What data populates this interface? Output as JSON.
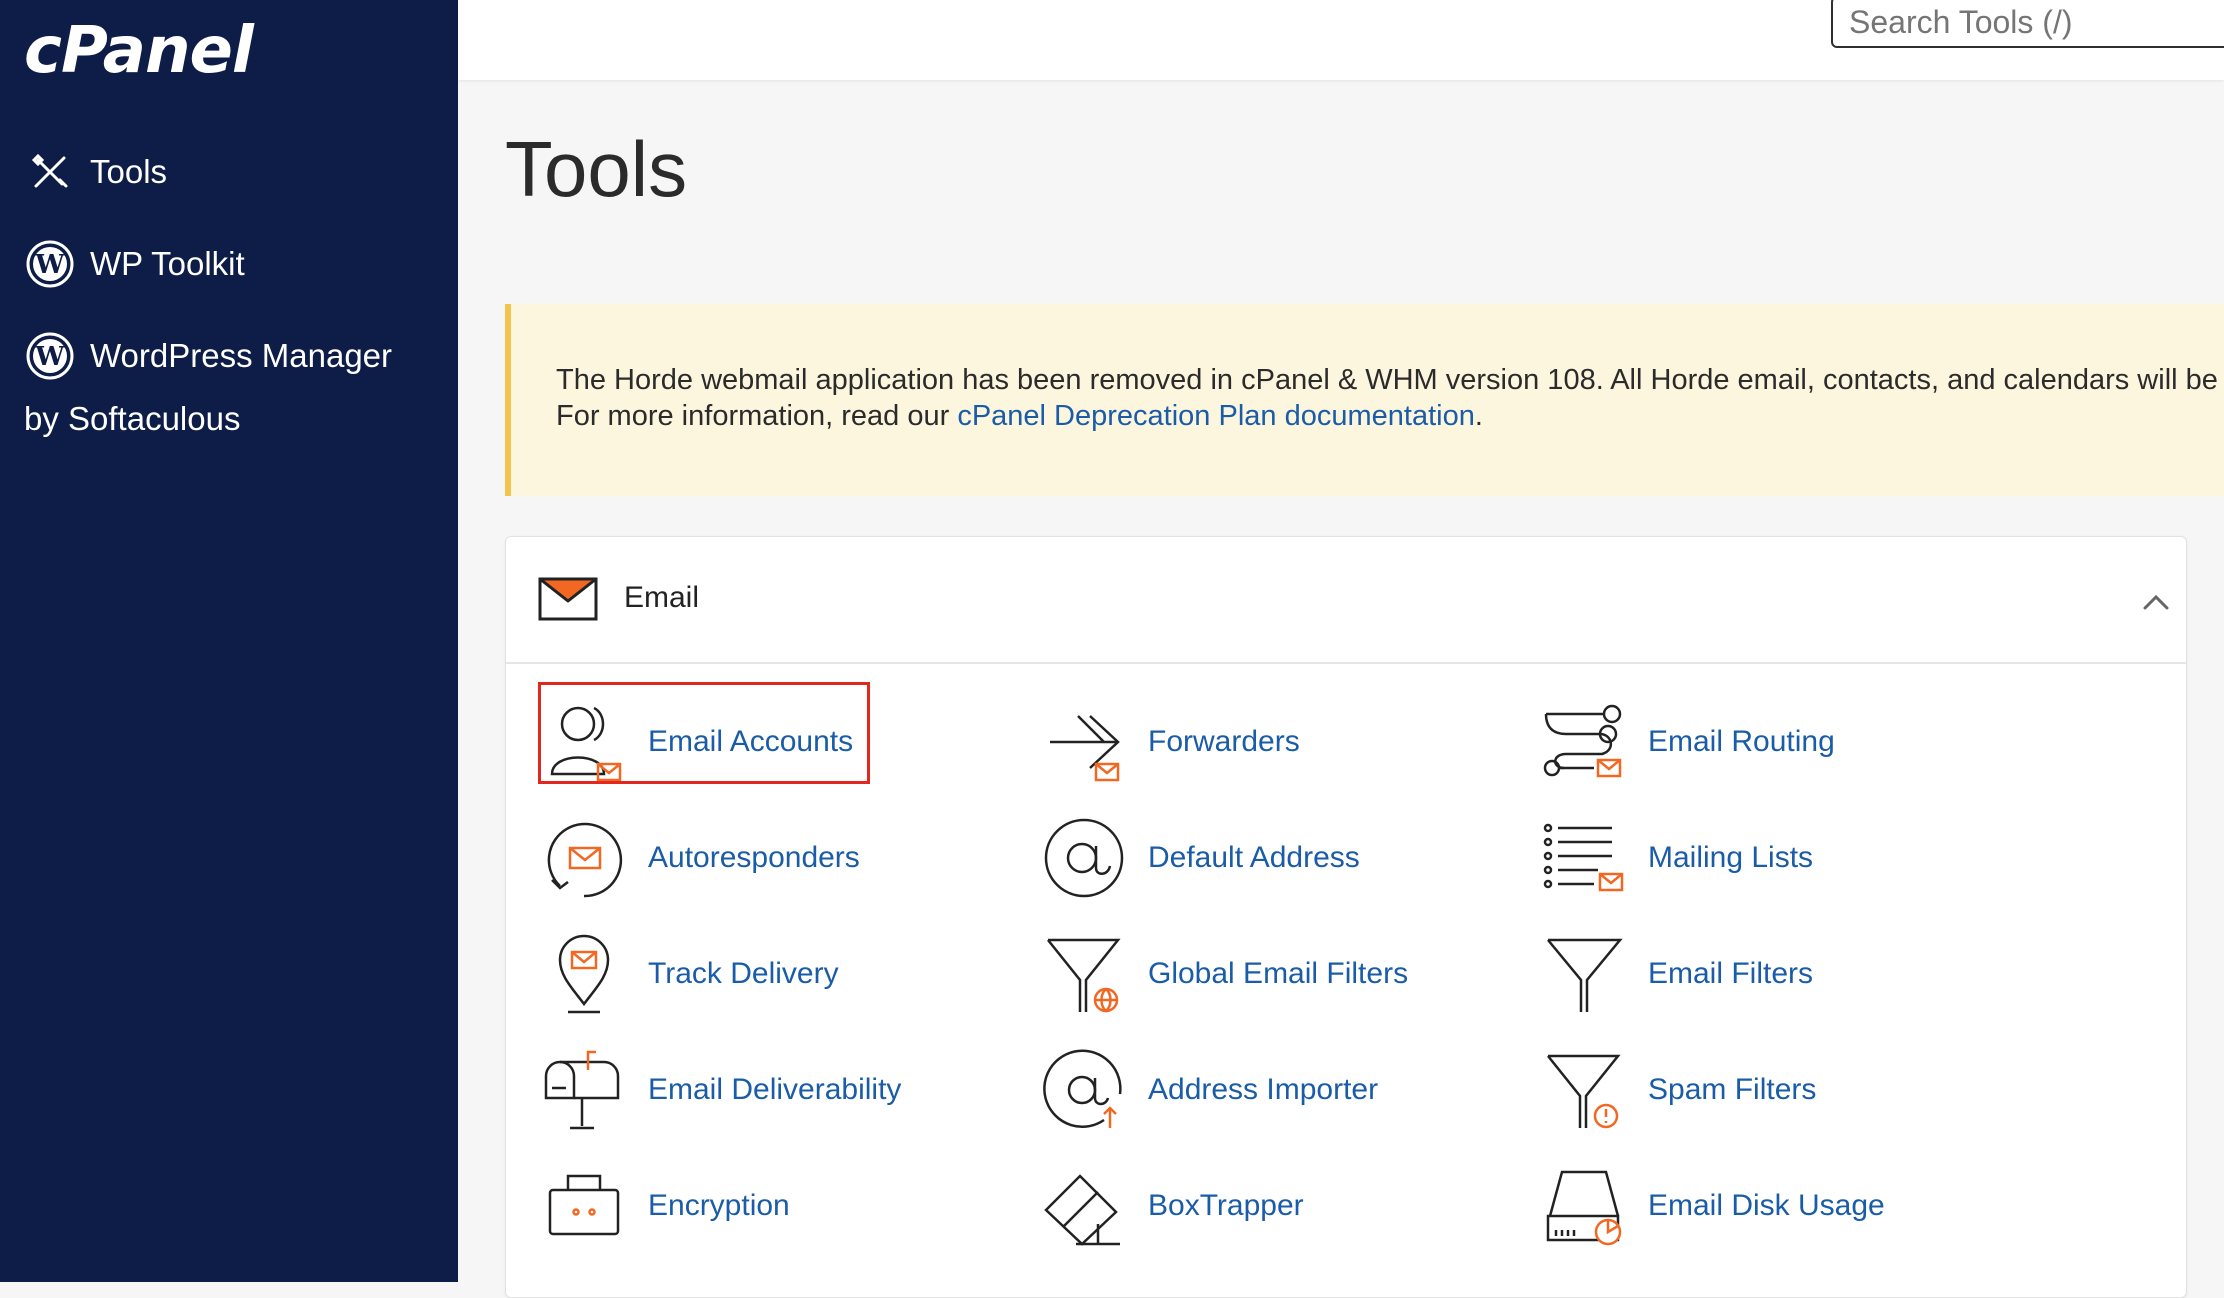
{
  "app": {
    "logo_text": "cPanel"
  },
  "sidebar": {
    "items": [
      {
        "label": "Tools",
        "icon": "tools-icon"
      },
      {
        "label": "WP Toolkit",
        "icon": "wordpress-icon"
      },
      {
        "label": "WordPress Manager",
        "sublabel": "by Softaculous",
        "icon": "wordpress-icon"
      }
    ]
  },
  "search": {
    "placeholder": "Search Tools (/)"
  },
  "page": {
    "title": "Tools"
  },
  "notice": {
    "line1": "The Horde webmail application has been removed in cPanel & WHM version 108. All Horde email, contacts, and calendars will be",
    "line2_prefix": "For more information, read our ",
    "line2_link": "cPanel Deprecation Plan documentation",
    "line2_suffix": "."
  },
  "email_section": {
    "title": "Email",
    "tools": [
      {
        "label": "Email Accounts",
        "icon": "email-accounts-icon"
      },
      {
        "label": "Forwarders",
        "icon": "forwarders-icon"
      },
      {
        "label": "Email Routing",
        "icon": "email-routing-icon"
      },
      {
        "label": "Autoresponders",
        "icon": "autoresponders-icon"
      },
      {
        "label": "Default Address",
        "icon": "default-address-icon"
      },
      {
        "label": "Mailing Lists",
        "icon": "mailing-lists-icon"
      },
      {
        "label": "Track Delivery",
        "icon": "track-delivery-icon"
      },
      {
        "label": "Global Email Filters",
        "icon": "global-email-filters-icon"
      },
      {
        "label": "Email Filters",
        "icon": "email-filters-icon"
      },
      {
        "label": "Email Deliverability",
        "icon": "email-deliverability-icon"
      },
      {
        "label": "Address Importer",
        "icon": "address-importer-icon"
      },
      {
        "label": "Spam Filters",
        "icon": "spam-filters-icon"
      },
      {
        "label": "Encryption",
        "icon": "encryption-icon"
      },
      {
        "label": "BoxTrapper",
        "icon": "boxtrapper-icon"
      },
      {
        "label": "Email Disk Usage",
        "icon": "email-disk-usage-icon"
      }
    ]
  },
  "colors": {
    "sidebar_bg": "#0e1d47",
    "link": "#1a5ca8",
    "accent_orange": "#f26822",
    "notice_bg": "#fcf6de",
    "notice_border": "#f1c44e",
    "highlight": "#e3261e"
  }
}
